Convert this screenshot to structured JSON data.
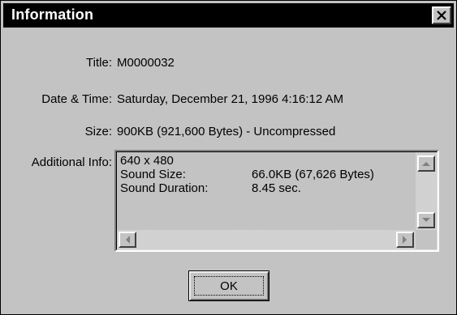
{
  "window": {
    "title": "Information",
    "close_icon": "close-icon"
  },
  "fields": [
    {
      "label": "Title:",
      "value": "M0000032"
    },
    {
      "label": "Date & Time:",
      "value": "Saturday, December 21, 1996 4:16:12 AM"
    },
    {
      "label": "Size:",
      "value": "900KB (921,600 Bytes)  - Uncompressed"
    }
  ],
  "additional": {
    "label": "Additional Info:",
    "resolution": "640 x 480",
    "sound_size_label": "Sound Size:",
    "sound_size_value": "66.0KB (67,626 Bytes)",
    "sound_duration_label": "Sound Duration:",
    "sound_duration_value": "8.45 sec."
  },
  "buttons": {
    "ok": "OK"
  },
  "colors": {
    "titlebar": "#000000",
    "face": "#c3c3c3"
  }
}
